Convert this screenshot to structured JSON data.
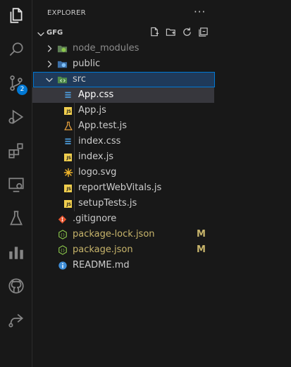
{
  "activity_bar": {
    "items": [
      {
        "icon": "files-icon",
        "active": true
      },
      {
        "icon": "search-icon"
      },
      {
        "icon": "source-control-icon",
        "badge": "2"
      },
      {
        "icon": "run-debug-icon"
      },
      {
        "icon": "extensions-icon"
      },
      {
        "icon": "remote-explorer-icon"
      },
      {
        "icon": "testing-icon"
      },
      {
        "icon": "charts-icon"
      },
      {
        "icon": "github-icon"
      },
      {
        "icon": "live-share-icon"
      }
    ]
  },
  "explorer": {
    "title": "EXPLORER",
    "more": "···",
    "folder": "GFG",
    "header_actions": [
      "new-file-icon",
      "new-folder-icon",
      "refresh-icon",
      "collapse-all-icon"
    ]
  },
  "tree": [
    {
      "label": "node_modules",
      "type": "folder",
      "icon": "node-modules-folder-icon",
      "muted": true
    },
    {
      "label": "public",
      "type": "folder",
      "icon": "public-folder-icon"
    },
    {
      "label": "src",
      "type": "folder",
      "icon": "src-folder-icon",
      "expanded": true,
      "selected": true
    },
    {
      "label": "App.css",
      "icon": "css-file-icon",
      "active": true
    },
    {
      "label": "App.js",
      "icon": "js-file-icon"
    },
    {
      "label": "App.test.js",
      "icon": "test-file-icon"
    },
    {
      "label": "index.css",
      "icon": "css-file-icon"
    },
    {
      "label": "index.js",
      "icon": "js-file-icon"
    },
    {
      "label": "logo.svg",
      "icon": "svg-file-icon"
    },
    {
      "label": "reportWebVitals.js",
      "icon": "js-file-icon"
    },
    {
      "label": "setupTests.js",
      "icon": "js-file-icon"
    },
    {
      "label": ".gitignore",
      "icon": "git-file-icon"
    },
    {
      "label": "package-lock.json",
      "icon": "npm-json-icon",
      "status": "M"
    },
    {
      "label": "package.json",
      "icon": "npm-json-icon",
      "status": "M"
    },
    {
      "label": "README.md",
      "icon": "info-file-icon"
    }
  ],
  "colors": {
    "accent": "#0078d4",
    "modified": "#c7b46b",
    "js_yellow": "#f1cf4e",
    "css_blue": "#4fa3e8"
  }
}
